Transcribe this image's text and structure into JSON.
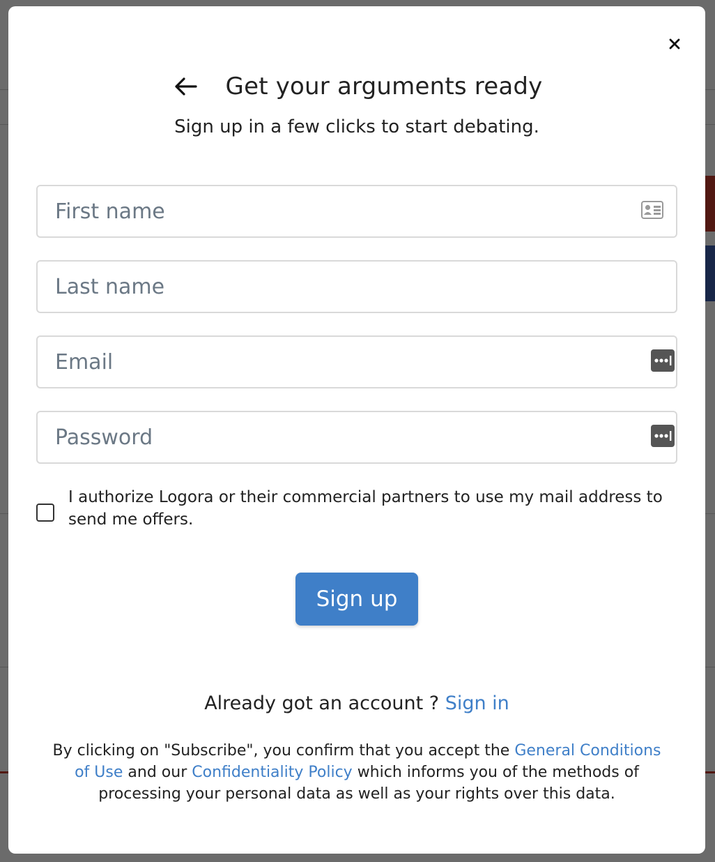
{
  "modal": {
    "title": "Get your arguments ready",
    "subtitle": "Sign up in a few clicks to start debating.",
    "close_icon": "close-icon",
    "back_icon": "arrow-left-icon"
  },
  "form": {
    "first_name": {
      "placeholder": "First name",
      "value": "",
      "icon": "contact-card-icon"
    },
    "last_name": {
      "placeholder": "Last name",
      "value": ""
    },
    "email": {
      "placeholder": "Email",
      "value": "",
      "icon": "password-manager-icon"
    },
    "password": {
      "placeholder": "Password",
      "value": "",
      "icon": "password-manager-icon"
    },
    "consent": {
      "checked": false,
      "label": "I authorize Logora or their commercial partners to use my mail address to send me offers."
    },
    "submit_label": "Sign up"
  },
  "signin": {
    "prompt": "Already got an account ?",
    "link_label": "Sign in"
  },
  "legal": {
    "part1": "By clicking on \"Subscribe\", you confirm that you accept the",
    "terms_link": "General Conditions of Use",
    "part2": "and our",
    "privacy_link": "Confidentiality Policy",
    "part3": "which informs you of the methods of processing your personal data as well as your rights over this data."
  },
  "colors": {
    "accent": "#3f7fc8",
    "overlay": "rgba(0,0,0,0.58)",
    "field_border": "#d9d9d9",
    "placeholder": "#6b7885"
  }
}
